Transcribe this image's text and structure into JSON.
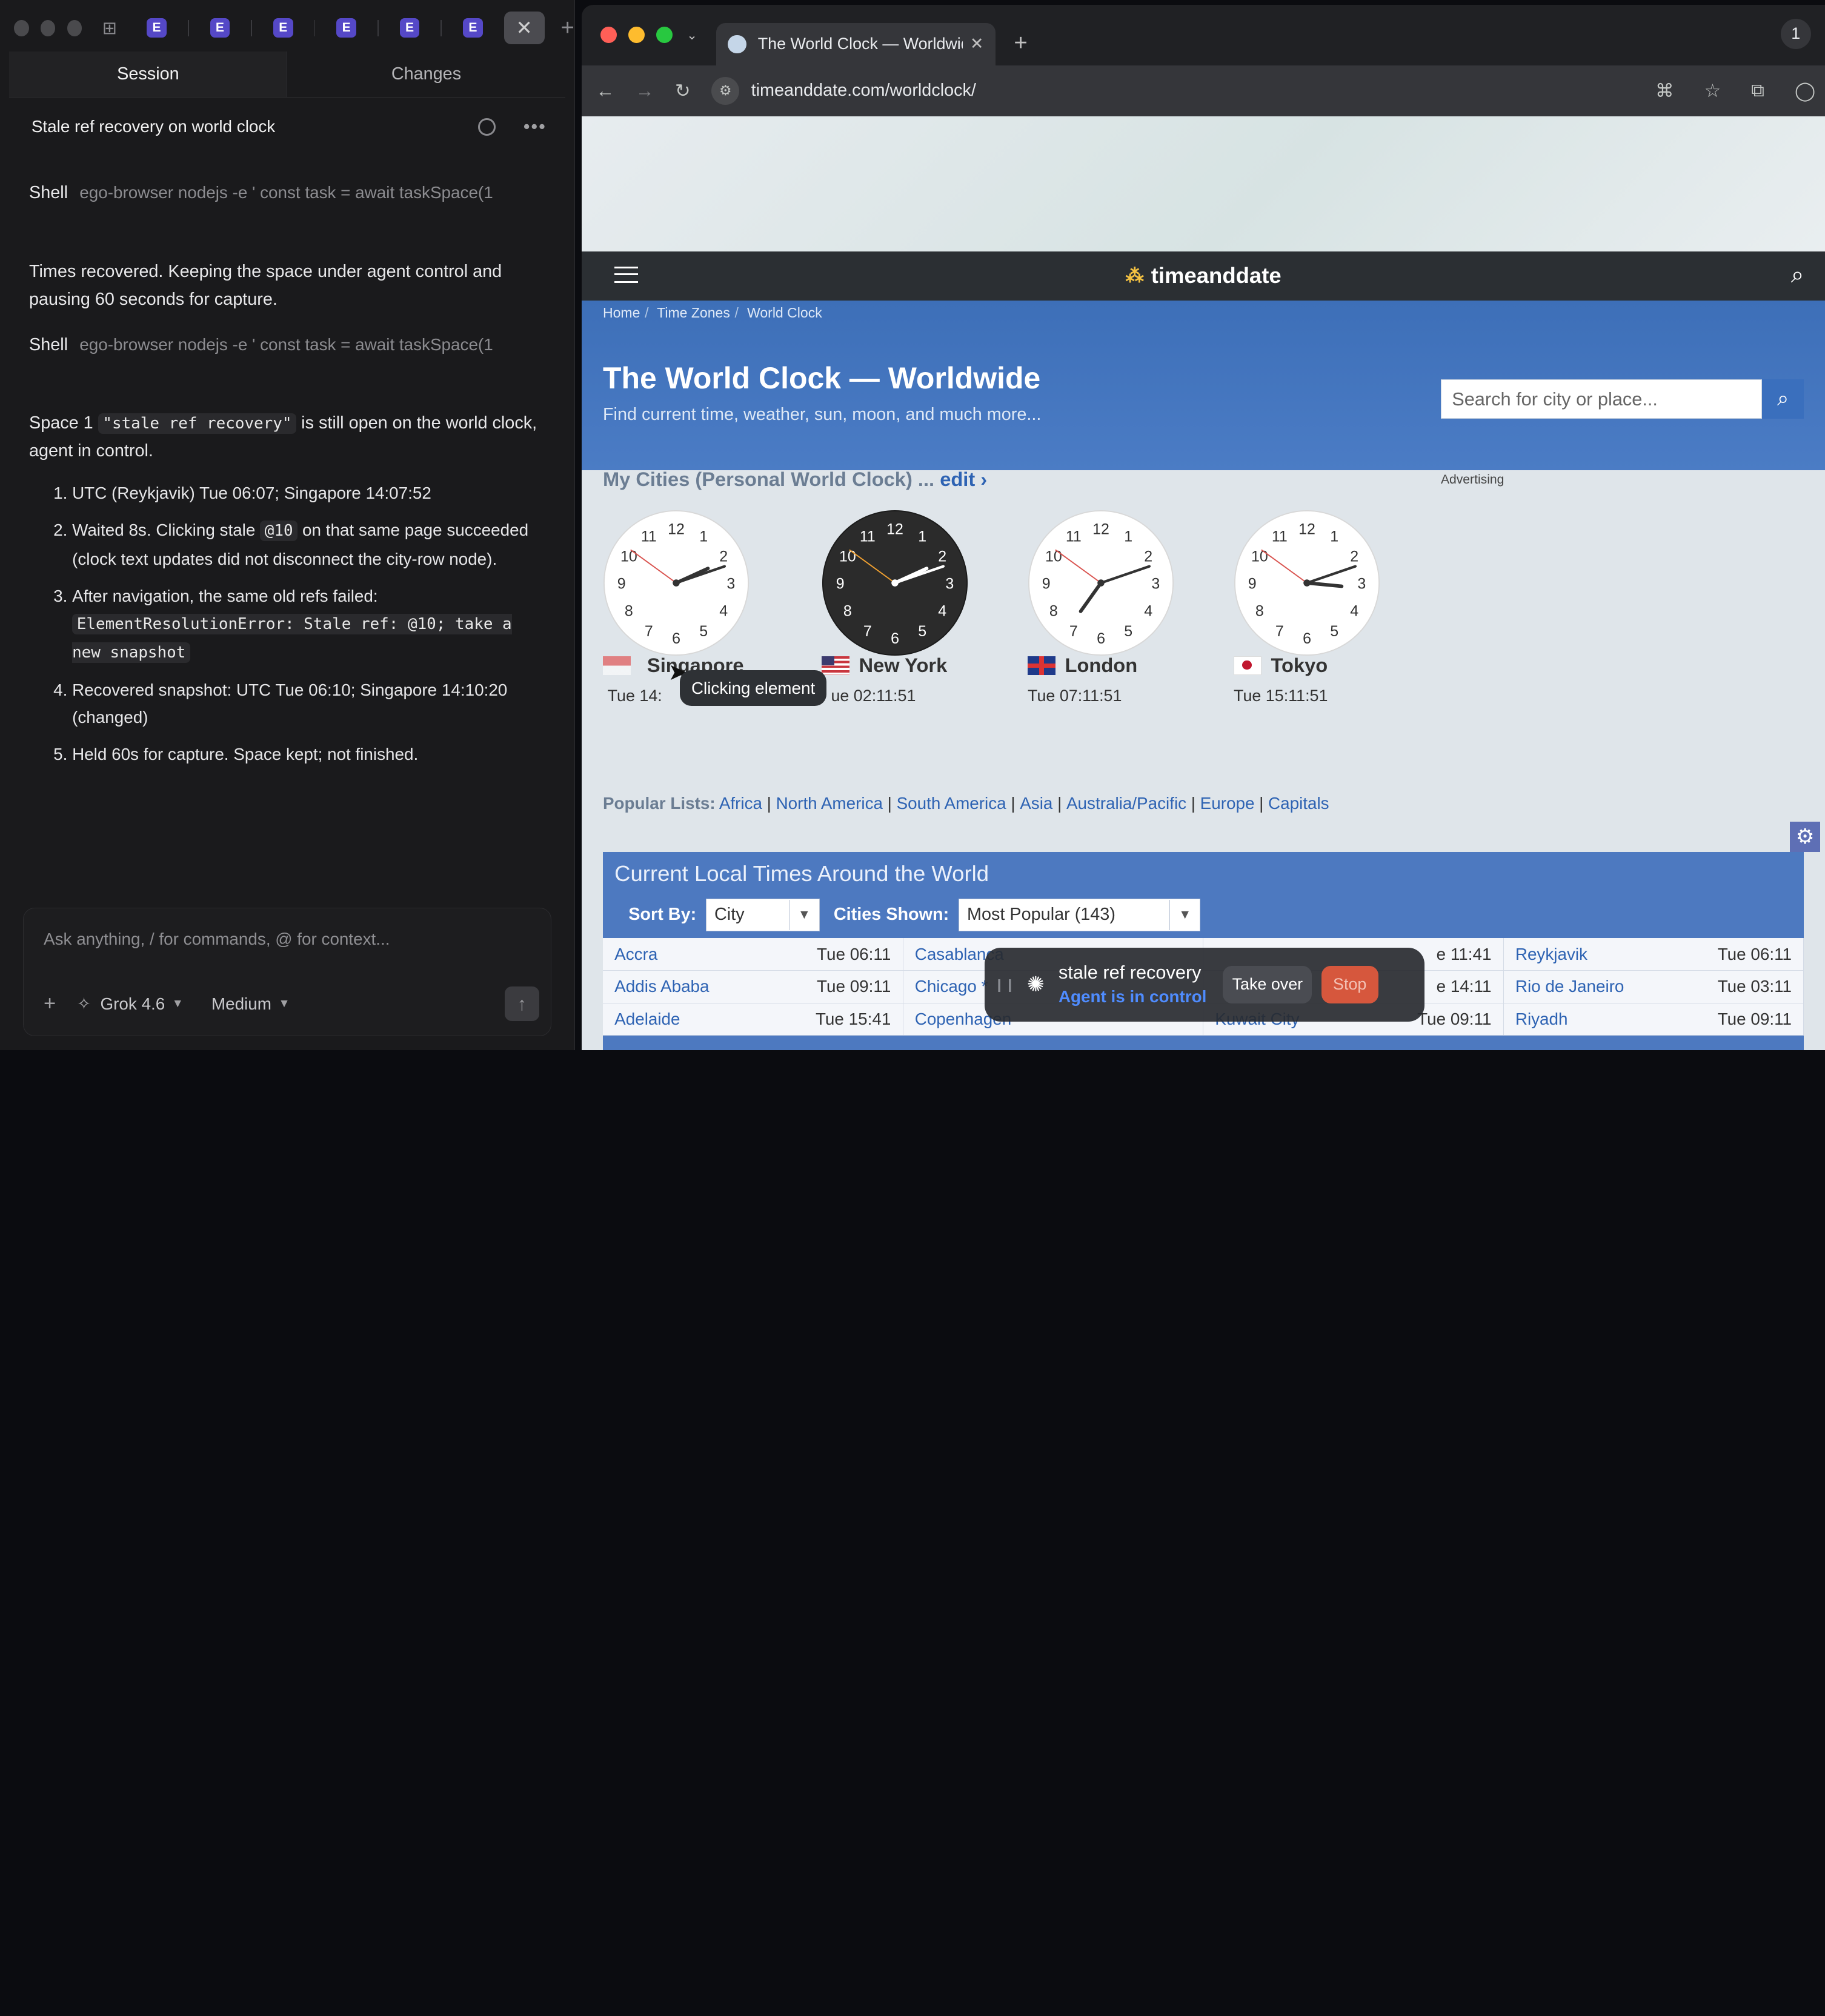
{
  "sidebar": {
    "tabs": {
      "session": "Session",
      "changes": "Changes"
    },
    "title": "Stale ref recovery on world clock",
    "shell1": {
      "label": "Shell",
      "cmd": "ego-browser nodejs -e ' const task = await taskSpace(1"
    },
    "msg1": "Times recovered. Keeping the space under agent control and pausing 60 seconds for capture.",
    "shell2": {
      "label": "Shell",
      "cmd": "ego-browser nodejs -e ' const task = await taskSpace(1"
    },
    "msg2_pre": "Space 1 ",
    "msg2_code": "\"stale ref recovery\"",
    "msg2_post": " is still open on the world clock, agent in control.",
    "steps": {
      "s1": "UTC (Reykjavik) Tue 06:07; Singapore 14:07:52",
      "s2_pre": "Waited 8s. Clicking stale ",
      "s2_code": "@10",
      "s2_post": " on that same page succeeded (clock text updates did not disconnect the city-row node).",
      "s3_pre": "After navigation, the same old refs failed: ",
      "s3_code": "ElementResolutionError: Stale ref: @10; take a new snapshot",
      "s4": "Recovered snapshot: UTC Tue 06:10; Singapore 14:10:20 (changed)",
      "s5": "Held 60s for capture. Space kept; not finished."
    },
    "input_placeholder": "Ask anything, / for commands, @ for context...",
    "model": "Grok 4.6",
    "effort": "Medium"
  },
  "browser": {
    "tab_title": "The World Clock — Worldwide",
    "tab_count": "1",
    "url": "timeanddate.com/worldclock/"
  },
  "site": {
    "logo": "timeanddate",
    "breadcrumb": {
      "home": "Home",
      "tz": "Time Zones",
      "wc": "World Clock"
    },
    "title": "The World Clock — Worldwide",
    "subtitle": "Find current time, weather, sun, moon, and much more...",
    "search_placeholder": "Search for city or place...",
    "mycities": "My Cities (Personal World Clock) ...",
    "edit": "edit ›",
    "advertising": "Advertising",
    "clocks": [
      {
        "city": "Singapore",
        "time": "Tue 14:",
        "hour": 2,
        "minute": 11,
        "second": 51,
        "dark": false
      },
      {
        "city": "New York",
        "time": "ue 02:11:51",
        "hour": 2,
        "minute": 11,
        "second": 51,
        "dark": true
      },
      {
        "city": "London",
        "time": "Tue 07:11:51",
        "hour": 7,
        "minute": 11,
        "second": 51,
        "dark": false
      },
      {
        "city": "Tokyo",
        "time": "Tue 15:11:51",
        "hour": 3,
        "minute": 11,
        "second": 51,
        "dark": false
      }
    ],
    "tooltip": "Clicking element",
    "popular_label": "Popular Lists:",
    "popular": [
      "Africa",
      "North America",
      "South America",
      "Asia",
      "Australia/Pacific",
      "Europe",
      "Capitals"
    ],
    "table_title": "Current Local Times Around the World",
    "sort_by": "Sort By:",
    "sort_value": "City",
    "cities_shown": "Cities Shown:",
    "cities_value": "Most Popular (143)",
    "rows": [
      [
        [
          "Accra",
          "Tue 06:11"
        ],
        [
          "Casablanca",
          ""
        ],
        [
          "",
          "e 11:41"
        ],
        [
          "Reykjavik",
          "Tue 06:11"
        ]
      ],
      [
        [
          "Addis Ababa",
          "Tue 09:11"
        ],
        [
          "Chicago *",
          ""
        ],
        [
          "",
          "e 14:11"
        ],
        [
          "Rio de Janeiro",
          "Tue 03:11"
        ]
      ],
      [
        [
          "Adelaide",
          "Tue 15:41"
        ],
        [
          "Copenhagen",
          ""
        ],
        [
          "Kuwait City",
          "Tue 09:11"
        ],
        [
          "Riyadh",
          "Tue 09:11"
        ]
      ]
    ]
  },
  "agent": {
    "name": "stale ref recovery",
    "status": "Agent is in control",
    "take_over": "Take over",
    "stop": "Stop"
  }
}
